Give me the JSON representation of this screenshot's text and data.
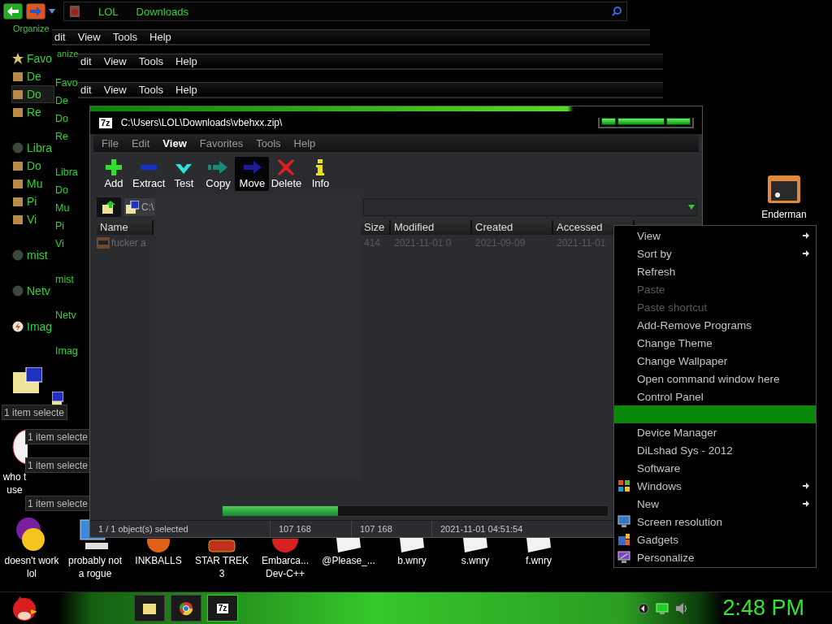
{
  "explorer": {
    "breadcrumb": [
      "LOL",
      "Downloads"
    ],
    "organize_labels": [
      "Organize",
      "anize"
    ],
    "menu_bars": [
      {
        "items": [
          "dit",
          "View",
          "Tools",
          "Help"
        ]
      },
      {
        "items": [
          "dit",
          "View",
          "Tools",
          "Help"
        ]
      },
      {
        "items": [
          "dit",
          "View",
          "Tools",
          "Help"
        ]
      }
    ],
    "nav_columns": [
      {
        "sections": [
          {
            "items": [
              {
                "label": "Favo",
                "kind": "star",
                "selected": false
              },
              {
                "label": "De",
                "kind": "folder",
                "selected": false
              },
              {
                "label": "Do",
                "kind": "folder",
                "selected": true
              },
              {
                "label": "Re",
                "kind": "folder",
                "selected": false
              }
            ]
          },
          {
            "items": [
              {
                "label": "Libra",
                "kind": "disc",
                "selected": false
              },
              {
                "label": "Do",
                "kind": "folder",
                "selected": false
              },
              {
                "label": "Mu",
                "kind": "folder",
                "selected": false
              },
              {
                "label": "Pi",
                "kind": "folder",
                "selected": false
              },
              {
                "label": "Vi",
                "kind": "folder",
                "selected": false
              }
            ]
          },
          {
            "items": [
              {
                "label": "mist",
                "kind": "disc",
                "selected": false
              }
            ]
          },
          {
            "items": [
              {
                "label": "Netv",
                "kind": "disc",
                "selected": false
              }
            ]
          },
          {
            "items": [
              {
                "label": "Imag",
                "kind": "flash",
                "selected": false
              }
            ]
          }
        ]
      },
      {
        "sections": [
          {
            "items": [
              {
                "label": "Favo",
                "kind": "none",
                "selected": false
              },
              {
                "label": "De",
                "kind": "none",
                "selected": false
              },
              {
                "label": "Do",
                "kind": "none",
                "selected": false
              },
              {
                "label": "Re",
                "kind": "none",
                "selected": false
              }
            ]
          },
          {
            "items": [
              {
                "label": "Libra",
                "kind": "none",
                "selected": false
              },
              {
                "label": "Do",
                "kind": "none",
                "selected": false
              },
              {
                "label": "Mu",
                "kind": "none",
                "selected": false
              },
              {
                "label": "Pi",
                "kind": "none",
                "selected": false
              },
              {
                "label": "Vi",
                "kind": "none",
                "selected": false
              }
            ]
          },
          {
            "items": [
              {
                "label": "mist",
                "kind": "none",
                "selected": false
              }
            ]
          },
          {
            "items": [
              {
                "label": "Netv",
                "kind": "none",
                "selected": false
              }
            ]
          },
          {
            "items": [
              {
                "label": "Imag",
                "kind": "none",
                "selected": false
              }
            ]
          }
        ]
      }
    ],
    "status_texts": [
      "1 item selecte",
      "1 item selecte",
      "1 item selecte",
      "1 item selecte"
    ],
    "desktop_item": {
      "label": "who t\nuse"
    }
  },
  "archive_window": {
    "logo": "7z",
    "title": "C:\\Users\\LOL\\Downloads\\vbehxx.zip\\",
    "menu": [
      {
        "label": "File",
        "selected": false
      },
      {
        "label": "Edit",
        "selected": false
      },
      {
        "label": "View",
        "selected": true
      },
      {
        "label": "Favorites",
        "selected": false
      },
      {
        "label": "Tools",
        "selected": false
      },
      {
        "label": "Help",
        "selected": false
      }
    ],
    "toolbar": [
      {
        "label": "Add",
        "kind": "add",
        "selected": false
      },
      {
        "label": "Extract",
        "kind": "extract",
        "selected": false
      },
      {
        "label": "Test",
        "kind": "test",
        "selected": false
      },
      {
        "label": "Copy",
        "kind": "copy",
        "selected": false
      },
      {
        "label": "Move",
        "kind": "move",
        "selected": true
      },
      {
        "label": "Delete",
        "kind": "delete",
        "selected": false
      },
      {
        "label": "Info",
        "kind": "info",
        "selected": false
      }
    ],
    "path": "C:\\",
    "columns": [
      "Name",
      "Size",
      "Modified",
      "Created",
      "Accessed"
    ],
    "rows": [
      {
        "name": "fucker a",
        "size": "414",
        "modified": "2021-11-01 0",
        "created": "2021-09-09",
        "accessed": "2021-11-01"
      }
    ],
    "progress": {
      "level": 0.3
    },
    "status_bar": [
      "1 / 1 object(s) selected",
      "107 168",
      "107 168",
      "2021-11-01 04:51:54"
    ]
  },
  "context_menu": {
    "items": [
      {
        "label": "View",
        "kind": "plain",
        "submenu": true,
        "disabled": false,
        "selected": false
      },
      {
        "label": "Sort by",
        "kind": "plain",
        "submenu": true,
        "disabled": false,
        "selected": false
      },
      {
        "label": "Refresh",
        "kind": "plain",
        "submenu": false,
        "disabled": false,
        "selected": false
      },
      {
        "label": "Paste",
        "kind": "plain",
        "submenu": false,
        "disabled": true,
        "selected": false
      },
      {
        "label": "Paste shortcut",
        "kind": "plain",
        "submenu": false,
        "disabled": true,
        "selected": false
      },
      {
        "label": "Add-Remove Programs",
        "kind": "plain",
        "submenu": false,
        "disabled": false,
        "selected": false
      },
      {
        "label": "Change Theme",
        "kind": "plain",
        "submenu": false,
        "disabled": false,
        "selected": false
      },
      {
        "label": "Change Wallpaper",
        "kind": "plain",
        "submenu": false,
        "disabled": false,
        "selected": false
      },
      {
        "label": "Open command window here",
        "kind": "plain",
        "submenu": false,
        "disabled": false,
        "selected": false
      },
      {
        "label": "Control Panel",
        "kind": "plain",
        "submenu": false,
        "disabled": false,
        "selected": false
      },
      {
        "kind": "plain",
        "submenu": false,
        "disabled": false,
        "selected": true
      },
      {
        "label": "Device Manager",
        "kind": "plain",
        "submenu": false,
        "disabled": false,
        "selected": false
      },
      {
        "label": "DiLshad Sys - 2012",
        "kind": "plain",
        "submenu": false,
        "disabled": false,
        "selected": false
      },
      {
        "label": "Software",
        "kind": "plain",
        "submenu": false,
        "disabled": false,
        "selected": false
      },
      {
        "label": "Windows",
        "kind": "windows",
        "submenu": true,
        "disabled": false,
        "selected": false
      },
      {
        "label": "New",
        "kind": "plain",
        "submenu": true,
        "disabled": false,
        "selected": false
      },
      {
        "label": "Screen resolution",
        "kind": "display",
        "submenu": false,
        "disabled": false,
        "selected": false
      },
      {
        "label": "Gadgets",
        "kind": "gadgets",
        "submenu": false,
        "disabled": false,
        "selected": false
      },
      {
        "label": "Personalize",
        "kind": "personalize",
        "submenu": false,
        "disabled": false,
        "selected": false
      }
    ]
  },
  "corner_icon": {
    "label": "Enderman"
  },
  "desktop_icons": [
    {
      "label": "doesn't work\nlol",
      "kind": "messenger"
    },
    {
      "label": "probably not\na rogue",
      "kind": "computer"
    },
    {
      "label": "INKBALLS",
      "kind": "game"
    },
    {
      "label": "STAR TREK\n3",
      "kind": "badge"
    },
    {
      "label": "Embarca...\nDev-C++",
      "kind": "ide"
    },
    {
      "label": "@Please_...",
      "kind": "document"
    },
    {
      "label": "b.wnry",
      "kind": "document"
    },
    {
      "label": "s.wnry",
      "kind": "document"
    },
    {
      "label": "f.wnry",
      "kind": "document"
    }
  ],
  "taskbar": {
    "buttons": [
      {
        "kind": "folder",
        "selected": false
      },
      {
        "kind": "browser",
        "selected": false
      },
      {
        "kind": "archiver",
        "label": "7z",
        "selected": true
      }
    ],
    "clock": "2:48 PM"
  }
}
